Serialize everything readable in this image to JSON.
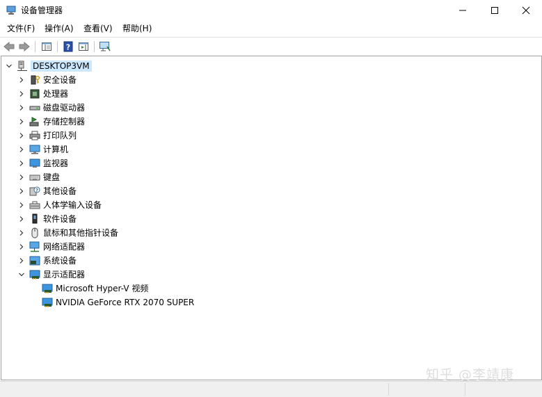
{
  "window": {
    "title": "设备管理器",
    "controls": {
      "minimize": "—",
      "maximize": "☐",
      "close": "✕"
    }
  },
  "menu": {
    "items": [
      {
        "label": "文件(F)"
      },
      {
        "label": "操作(A)"
      },
      {
        "label": "查看(V)"
      },
      {
        "label": "帮助(H)"
      }
    ]
  },
  "toolbar": {
    "buttons": [
      "back-icon",
      "forward-icon",
      "show-hide-console-tree-icon",
      "help-icon",
      "action-pane-icon",
      "scan-hardware-icon"
    ]
  },
  "tree": {
    "root": {
      "label": "DESKTOP3VM",
      "expanded": true,
      "selected": true
    },
    "categories": [
      {
        "label": "安全设备",
        "icon": "security-device-icon"
      },
      {
        "label": "处理器",
        "icon": "processor-icon"
      },
      {
        "label": "磁盘驱动器",
        "icon": "disk-drive-icon"
      },
      {
        "label": "存储控制器",
        "icon": "storage-controller-icon"
      },
      {
        "label": "打印队列",
        "icon": "printer-icon"
      },
      {
        "label": "计算机",
        "icon": "computer-icon"
      },
      {
        "label": "监视器",
        "icon": "monitor-icon"
      },
      {
        "label": "键盘",
        "icon": "keyboard-icon"
      },
      {
        "label": "其他设备",
        "icon": "other-device-icon"
      },
      {
        "label": "人体学输入设备",
        "icon": "hid-icon"
      },
      {
        "label": "软件设备",
        "icon": "software-device-icon"
      },
      {
        "label": "鼠标和其他指针设备",
        "icon": "mouse-icon"
      },
      {
        "label": "网络适配器",
        "icon": "network-adapter-icon"
      },
      {
        "label": "系统设备",
        "icon": "system-device-icon"
      },
      {
        "label": "显示适配器",
        "icon": "display-adapter-icon",
        "expanded": true
      }
    ],
    "display_adapters": [
      {
        "label": "Microsoft Hyper-V 视频"
      },
      {
        "label": "NVIDIA GeForce RTX 2070 SUPER"
      }
    ]
  },
  "watermark": "知乎 @李靖康"
}
